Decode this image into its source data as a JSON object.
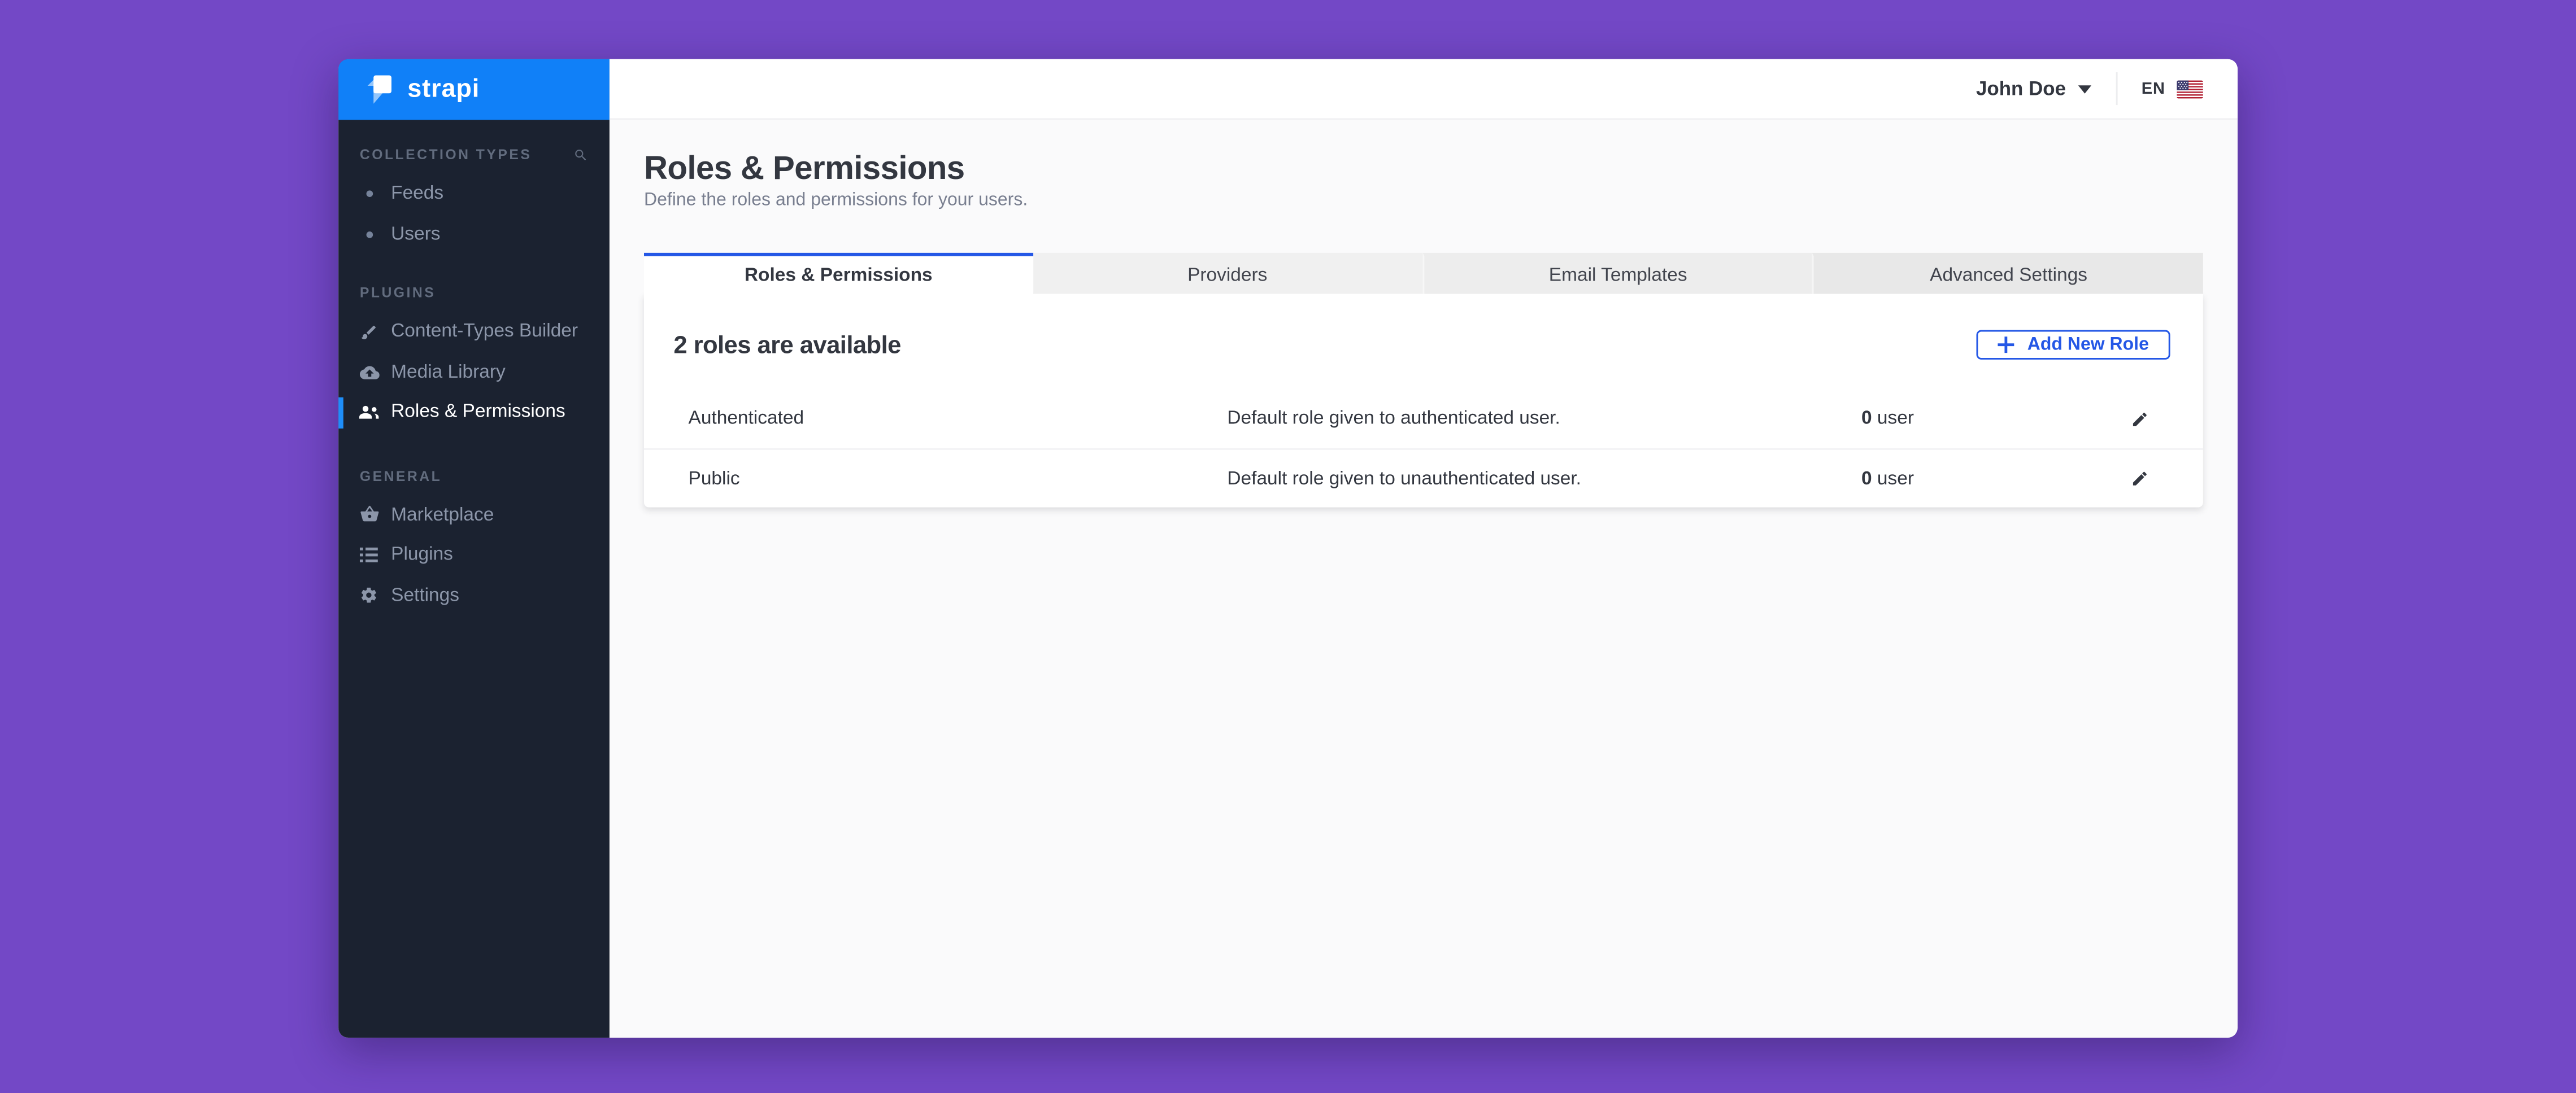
{
  "brand": {
    "name": "strapi"
  },
  "topbar": {
    "user_name": "John Doe",
    "language": "EN"
  },
  "sidebar": {
    "sections": [
      {
        "label": "COLLECTION TYPES",
        "items": [
          {
            "label": "Feeds",
            "icon": "bullet"
          },
          {
            "label": "Users",
            "icon": "bullet"
          }
        ]
      },
      {
        "label": "PLUGINS",
        "items": [
          {
            "label": "Content-Types Builder",
            "icon": "brush-icon"
          },
          {
            "label": "Media Library",
            "icon": "cloud-upload-icon"
          },
          {
            "label": "Roles & Permissions",
            "icon": "users-icon",
            "active": true
          }
        ]
      },
      {
        "label": "GENERAL",
        "items": [
          {
            "label": "Marketplace",
            "icon": "basket-icon"
          },
          {
            "label": "Plugins",
            "icon": "list-icon"
          },
          {
            "label": "Settings",
            "icon": "gear-icon"
          }
        ]
      }
    ]
  },
  "page": {
    "title": "Roles & Permissions",
    "subtitle": "Define the roles and permissions for your users."
  },
  "tabs": [
    {
      "label": "Roles & Permissions",
      "active": true
    },
    {
      "label": "Providers",
      "active": false
    },
    {
      "label": "Email Templates",
      "active": false
    },
    {
      "label": "Advanced Settings",
      "active": false
    }
  ],
  "roles_panel": {
    "heading": "2 roles are available",
    "add_button_label": "Add New Role",
    "rows": [
      {
        "name": "Authenticated",
        "description": "Default role given to authenticated user.",
        "count": "0",
        "count_label": "user"
      },
      {
        "name": "Public",
        "description": "Default role given to unauthenticated user.",
        "count": "0",
        "count_label": "user"
      }
    ]
  },
  "colors": {
    "background_purple": "#7348C6",
    "logo_blue": "#1080F8",
    "sidebar_bg": "#1B2230",
    "sidebar_active_bar": "#1E8EF9",
    "accent_blue": "#2457E6",
    "text_dark": "#333740",
    "content_bg": "#FAFAFB"
  }
}
